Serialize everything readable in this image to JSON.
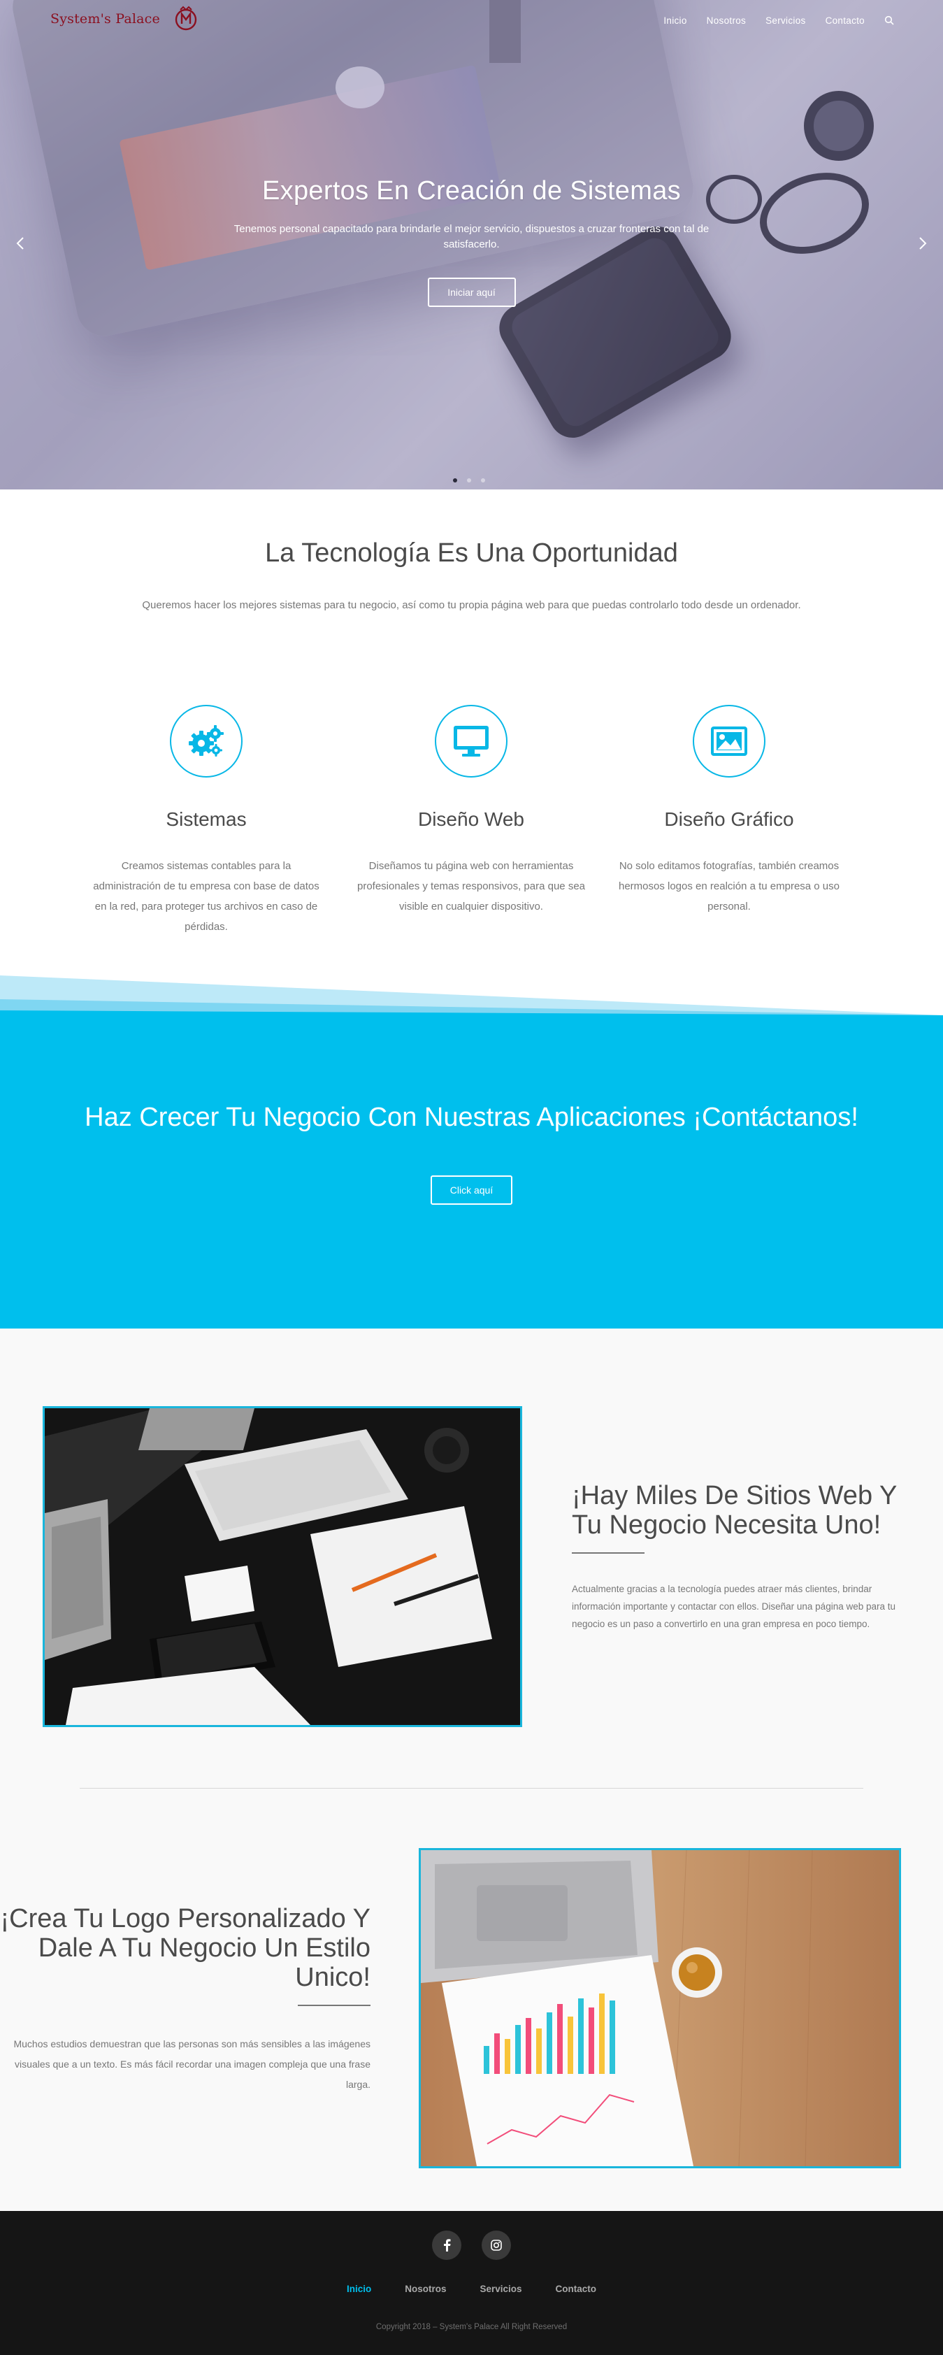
{
  "brand": {
    "name": "System's Palace",
    "color": "#8b1020"
  },
  "nav": {
    "items": [
      {
        "label": "Inicio"
      },
      {
        "label": "Nosotros"
      },
      {
        "label": "Servicios"
      },
      {
        "label": "Contacto"
      }
    ],
    "search_icon": "search-icon"
  },
  "hero": {
    "title": "Expertos En Creación de Sistemas",
    "subtitle": "Tenemos personal capacitado para brindarle el mejor servicio, dispuestos a cruzar fronteras con tal de satisfacerlo.",
    "button": "Iniciar aquí",
    "slides_total": 3,
    "active_slide": 1
  },
  "intro": {
    "title": "La Tecnología Es Una Oportunidad",
    "text": "Queremos hacer los mejores sistemas para tu negocio, así como tu propia página web para que puedas controlarlo todo desde un ordenador."
  },
  "features": [
    {
      "icon": "gears-icon",
      "title": "Sistemas",
      "text": "Creamos sistemas contables para la administración de tu empresa con base de datos en la red, para proteger tus archivos en caso de pérdidas."
    },
    {
      "icon": "monitor-icon",
      "title": "Diseño Web",
      "text": "Diseñamos tu página web con herramientas profesionales y temas responsivos, para que sea visible en cualquier dispositivo."
    },
    {
      "icon": "image-icon",
      "title": "Diseño Gráfico",
      "text": "No solo editamos fotografías, también creamos hermosos logos en realción a tu empresa o uso personal."
    }
  ],
  "cta": {
    "title": "Haz Crecer Tu Negocio Con Nuestras Aplicaciones ¡Contáctanos!",
    "button": "Click aquí"
  },
  "block1": {
    "title": "¡Hay Miles De Sitios Web Y Tu Negocio Necesita Uno!",
    "text": "Actualmente gracias a la tecnología puedes atraer más clientes, brindar información importante y contactar con ellos. Diseñar una página web para tu negocio es un paso a convertirlo en una gran empresa en poco tiempo."
  },
  "block2": {
    "title": "¡Crea Tu Logo Personalizado Y Dale A Tu Negocio Un Estilo Unico!",
    "text": "Muchos estudios demuestran que las personas son más sensibles a las imágenes visuales que a un texto. Es más fácil recordar una imagen compleja que una frase larga."
  },
  "footer": {
    "social": [
      "facebook-icon",
      "instagram-icon"
    ],
    "nav": [
      {
        "label": "Inicio"
      },
      {
        "label": "Nosotros"
      },
      {
        "label": "Servicios"
      },
      {
        "label": "Contacto"
      }
    ],
    "copyright": "Copyright 2018 – System's Palace All Right Reserved"
  },
  "colors": {
    "accent": "#00bfed",
    "footer": "#151515",
    "heading": "#4a4a4a"
  }
}
